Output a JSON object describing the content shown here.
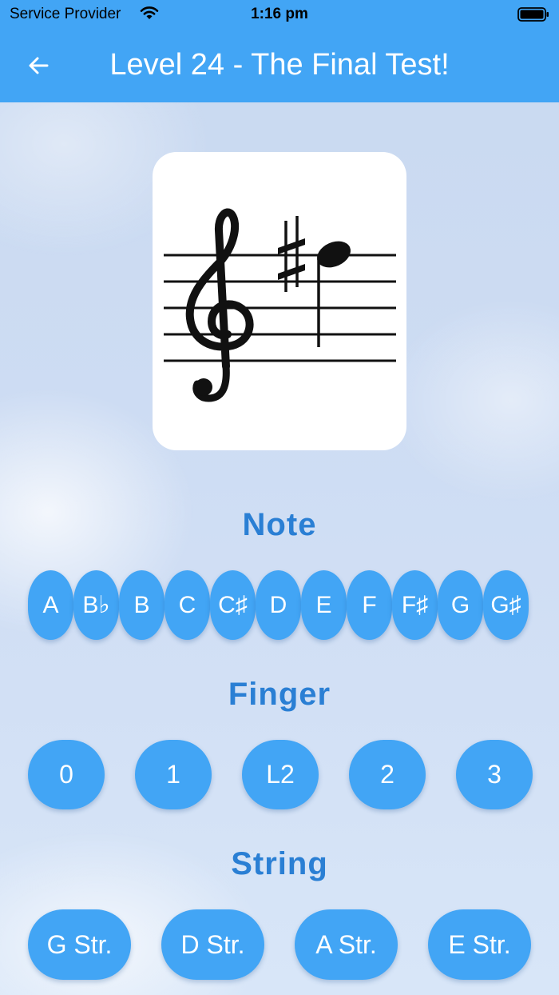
{
  "status_bar": {
    "carrier": "Service Provider",
    "time": "1:16 pm",
    "icons": [
      "wifi-icon",
      "battery-icon"
    ]
  },
  "app_bar": {
    "title": "Level 24 - The Final Test!",
    "back_icon": "arrow-left-icon"
  },
  "note_card": {
    "clef": "treble-clef",
    "accidental": "sharp",
    "note": "quarter-note"
  },
  "sections": {
    "note": {
      "heading": "Note",
      "options": [
        "A",
        "B♭",
        "B",
        "C",
        "C♯",
        "D",
        "E",
        "F",
        "F♯",
        "G",
        "G♯"
      ]
    },
    "finger": {
      "heading": "Finger",
      "options": [
        "0",
        "1",
        "L2",
        "2",
        "3"
      ]
    },
    "string": {
      "heading": "String",
      "options": [
        "G Str.",
        "D Str.",
        "A Str.",
        "E Str."
      ]
    }
  },
  "colors": {
    "primary": "#42a5f5",
    "heading": "#2a7fd4",
    "button_text": "#ffffff"
  }
}
